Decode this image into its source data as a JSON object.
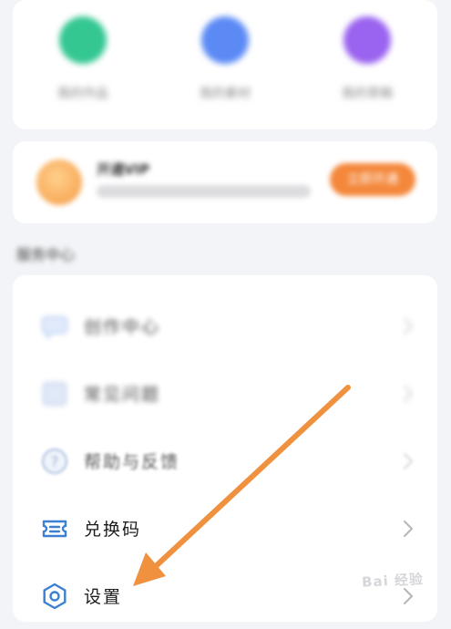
{
  "quick_actions": [
    {
      "label": "我的作品",
      "color": "#34c792"
    },
    {
      "label": "我的素材",
      "color": "#5b8af5"
    },
    {
      "label": "我的草稿",
      "color": "#9a63f0"
    }
  ],
  "vip": {
    "title": "开通VIP",
    "subtitle": "",
    "button_label": "立即开通"
  },
  "section_title": "服务中心",
  "menu": {
    "items": [
      {
        "label": "创作中心"
      },
      {
        "label": "常见问题"
      },
      {
        "label": "帮助与反馈"
      },
      {
        "label": "兑换码"
      },
      {
        "label": "设置"
      }
    ]
  },
  "annotation_arrow": {
    "color": "#f0913f"
  },
  "watermark": "Bai 经验"
}
